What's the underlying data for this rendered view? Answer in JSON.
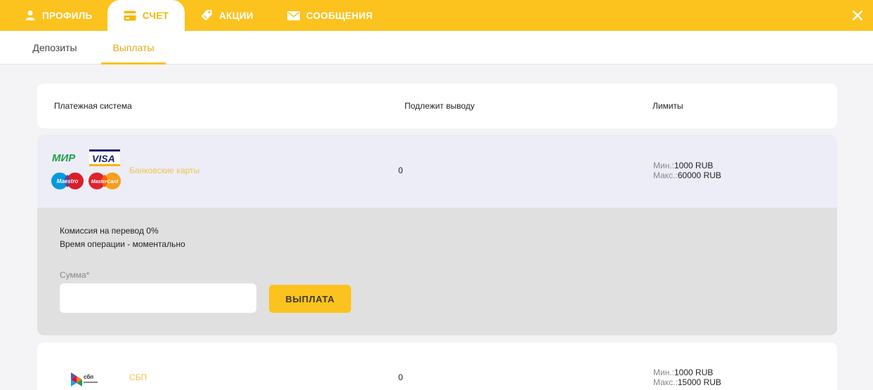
{
  "colors": {
    "accent": "#fcc21e",
    "row_highlight": "#ededf7",
    "details_bg": "#e0e0e0",
    "link_text": "#f0c14b"
  },
  "top_tabs": [
    {
      "label": "ПРОФИЛЬ",
      "icon": "user-icon"
    },
    {
      "label": "СЧЕТ",
      "icon": "wallet-icon",
      "active": true
    },
    {
      "label": "АКЦИИ",
      "icon": "tag-icon"
    },
    {
      "label": "СООБЩЕНИЯ",
      "icon": "envelope-icon"
    }
  ],
  "close_icon": "close-icon",
  "sub_tabs": [
    {
      "label": "Депозиты"
    },
    {
      "label": "Выплаты",
      "active": true
    }
  ],
  "table": {
    "headers": [
      "Платежная система",
      "Подлежит выводу",
      "Лимиты"
    ],
    "rows": [
      {
        "name": "Банковские карты",
        "logos": [
          "МИР",
          "VISA",
          "Maestro",
          "MasterCard"
        ],
        "amount": "0",
        "min_label": "Мин.:",
        "min_value": "1000 RUB",
        "max_label": "Макс.:",
        "max_value": "60000 RUB",
        "expanded": true,
        "details": {
          "commission": "Комиссия на перевод 0%",
          "time": "Время операции - моментально",
          "sum_label": "Сумма*",
          "sum_value": "",
          "button": "ВЫПЛАТА"
        }
      },
      {
        "name": "СБП",
        "logos": [
          "сбп"
        ],
        "amount": "0",
        "min_label": "Мин.:",
        "min_value": "1000 RUB",
        "max_label": "Макс.:",
        "max_value": "15000 RUB"
      }
    ]
  }
}
